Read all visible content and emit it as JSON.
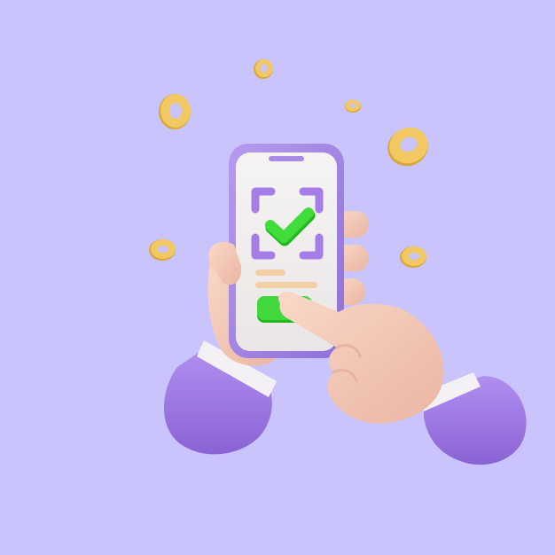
{
  "scene": {
    "description": "",
    "colors": {
      "background": "#c9c4fc",
      "phone_frame": "#a98be6",
      "phone_frame_dark": "#8f6fd8",
      "screen": "#f1efee",
      "scan_corners": "#a47ee6",
      "check": "#3fdc3a",
      "check_dark": "#22b820",
      "text_lines": "#f2cfa4",
      "button": "#42d83d",
      "sleeve": "#a883e8",
      "sleeve_dark": "#8c66d6",
      "cuff": "#f3f1f4",
      "skin": "#f6cdbb",
      "skin_shadow": "#e8b3a0",
      "coin": "#f2c862",
      "coin_dark": "#d9a83c"
    },
    "icons": [
      "phone-icon",
      "qr-scan-frame-icon",
      "checkmark-icon",
      "pointing-hand-icon",
      "coin-icon"
    ]
  }
}
